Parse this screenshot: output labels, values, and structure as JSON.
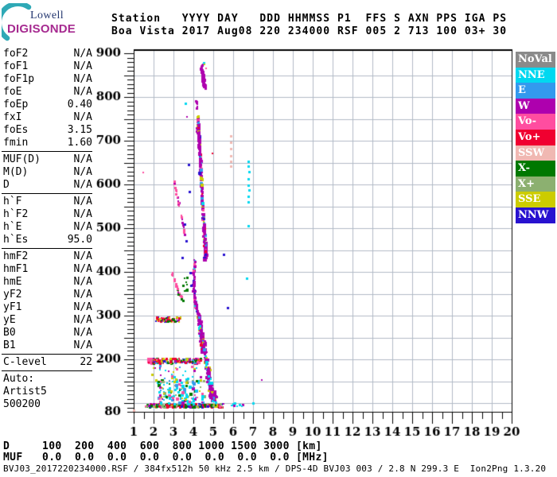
{
  "logo": {
    "top": "Lowell",
    "bottom": "DIGISONDE",
    "arc_color": "#2fa9b6"
  },
  "header": {
    "line1": "Station   YYYY DAY   DDD HHMMSS P1  FFS S AXN PPS IGA PS",
    "line2": "Boa Vista 2017 Aug08 220 234000 RSF 005 2 713 100 03+ 30"
  },
  "params": {
    "sections": [
      {
        "rows": [
          [
            "foF2",
            "N/A"
          ],
          [
            "foF1",
            "N/A"
          ],
          [
            "foF1p",
            "N/A"
          ],
          [
            "foE",
            "N/A"
          ],
          [
            "foEp",
            "0.40"
          ],
          [
            "fxI",
            "N/A"
          ],
          [
            "foEs",
            "3.15"
          ],
          [
            "fmin",
            "1.60"
          ]
        ]
      },
      {
        "rows": [
          [
            "MUF(D)",
            "N/A"
          ],
          [
            "M(D)",
            "N/A"
          ],
          [
            "D",
            "N/A"
          ]
        ]
      },
      {
        "rows": [
          [
            "h`F",
            "N/A"
          ],
          [
            "h`F2",
            "N/A"
          ],
          [
            "h`E",
            "N/A"
          ],
          [
            "h`Es",
            "95.0"
          ]
        ]
      },
      {
        "rows": [
          [
            "hmF2",
            "N/A"
          ],
          [
            "hmF1",
            "N/A"
          ],
          [
            "hmE",
            "N/A"
          ],
          [
            "yF2",
            "N/A"
          ],
          [
            "yF1",
            "N/A"
          ],
          [
            "yE",
            "N/A"
          ],
          [
            "B0",
            "N/A"
          ],
          [
            "B1",
            "N/A"
          ]
        ]
      },
      {
        "rows": [
          [
            "C-level",
            "22"
          ]
        ]
      }
    ],
    "footer": [
      "Auto:",
      "Artist5",
      "500200"
    ]
  },
  "legend": {
    "items": [
      "NoVal",
      "NNE",
      "E",
      "W",
      "Vo-",
      "Vo+",
      "SSW",
      "X-",
      "X+",
      "SSE",
      "NNW"
    ]
  },
  "footer": {
    "d_row": "D     100  200  400  600  800 1000 1500 3000 [km]",
    "muf_row": "MUF   0.0  0.0  0.0  0.0  0.0  0.0  0.0  0.0 [MHz]",
    "file_row": "BVJ03_2017220234000.RSF / 384fx512h 50 kHz 2.5 km / DPS-4D BVJ03 003 / 2.8 N 299.3 E  Ion2Png 1.3.20"
  },
  "chart_data": {
    "type": "scatter",
    "title": "Digisonde ionogram, Boa Vista, 2017 Aug08 day 220, 23:40:00",
    "xlabel": "[MHz]",
    "ylabel": "[km]",
    "xlim": [
      1,
      20
    ],
    "ylim": [
      80,
      900
    ],
    "xtick_labels": [
      1,
      2,
      3,
      4,
      5,
      6,
      7,
      8,
      9,
      10,
      11,
      12,
      13,
      14,
      15,
      16,
      17,
      18,
      19,
      20
    ],
    "ytick_labels": [
      900,
      800,
      700,
      600,
      500,
      400,
      300,
      200,
      80
    ],
    "x_minor_step": 0.5,
    "y_minor_step": 10,
    "x_grid_step": 1,
    "y_grid_step": 50,
    "grid": true,
    "grid_color": "#b2bac6",
    "legend_position": "right",
    "palette": {
      "NoVal": "#8a8a8a",
      "NNE": "#00d8f0",
      "E": "#3399ee",
      "W": "#ae00ae",
      "Vo-": "#ff4da0",
      "Vo+": "#f00030",
      "SSW": "#f0b8b2",
      "X-": "#007800",
      "X+": "#8cb070",
      "SSE": "#cccc00",
      "NNW": "#2812d0"
    },
    "features": [
      {
        "name": "spread-f-top-cluster",
        "kind": "path",
        "path": [
          [
            4.42,
            872
          ],
          [
            4.5,
            845
          ],
          [
            4.58,
            818
          ]
        ],
        "spread": [
          0.07,
          0.1
        ],
        "hj": 7,
        "count": 60,
        "colors": [
          "W",
          "W",
          "W",
          "W",
          "W",
          "W",
          "W",
          "W",
          "W",
          "Vo-"
        ],
        "size": [
          2,
          4
        ]
      },
      {
        "name": "upper-sparse-column",
        "kind": "path",
        "path": [
          [
            4.17,
            790
          ],
          [
            4.22,
            745
          ],
          [
            4.2,
            712
          ]
        ],
        "spread": [
          0.03,
          0.05
        ],
        "hj": 8,
        "count": 16,
        "colors": [
          "W"
        ],
        "size": [
          2,
          3
        ]
      },
      {
        "name": "main-spread-column",
        "kind": "path",
        "path": [
          [
            4.22,
            758
          ],
          [
            4.3,
            700
          ],
          [
            4.36,
            645
          ],
          [
            4.44,
            572
          ],
          [
            4.55,
            500
          ],
          [
            4.62,
            452
          ],
          [
            4.6,
            428
          ]
        ],
        "spread": [
          0.05,
          0.1
        ],
        "hj": 6,
        "count": 280,
        "colors": [
          "W",
          "W",
          "W",
          "W",
          "W",
          "W",
          "W",
          "W",
          "W",
          "W",
          "W",
          "W",
          "E",
          "NNE",
          "SSE",
          "Vo+",
          "NNW",
          "Vo-"
        ],
        "size": [
          2,
          4
        ]
      },
      {
        "name": "mid-column",
        "kind": "path",
        "path": [
          [
            4.1,
            428
          ],
          [
            4.04,
            395
          ],
          [
            4.03,
            362
          ],
          [
            4.1,
            330
          ],
          [
            4.22,
            305
          ]
        ],
        "spread": [
          0.05,
          0.09
        ],
        "hj": 6,
        "count": 130,
        "colors": [
          "W",
          "W",
          "W",
          "W",
          "W",
          "W",
          "W",
          "W",
          "W",
          "W",
          "NNW",
          "X-",
          "NNE",
          "Vo-"
        ],
        "size": [
          2,
          3
        ]
      },
      {
        "name": "f-trace-funnel",
        "kind": "path",
        "path": [
          [
            4.28,
            300
          ],
          [
            4.38,
            268
          ],
          [
            4.48,
            238
          ],
          [
            4.55,
            212
          ]
        ],
        "spread": [
          0.09,
          0.16
        ],
        "hj": 6,
        "count": 170,
        "colors": [
          "W",
          "W",
          "W",
          "W",
          "W",
          "W",
          "W",
          "W",
          "W",
          "NNE",
          "E",
          "SSE",
          "Vo+"
        ],
        "size": [
          2,
          4
        ]
      },
      {
        "name": "lower-spread",
        "kind": "path",
        "path": [
          [
            4.62,
            205
          ],
          [
            4.75,
            165
          ],
          [
            4.9,
            128
          ],
          [
            5.02,
            104
          ]
        ],
        "spread": [
          0.12,
          0.25
        ],
        "hj": 7,
        "count": 150,
        "colors": [
          "W",
          "W",
          "W",
          "W",
          "W",
          "W",
          "W",
          "W",
          "NNE",
          "NNE",
          "E",
          "SSE"
        ],
        "size": [
          2,
          4
        ]
      },
      {
        "name": "oblique-trace-upper",
        "kind": "path",
        "path": [
          [
            3.02,
            610
          ],
          [
            3.3,
            548
          ],
          [
            3.58,
            485
          ]
        ],
        "spread": [
          0.03,
          0.03
        ],
        "hj": 5,
        "count": 28,
        "colors": [
          "Vo-",
          "Vo-",
          "Vo-",
          "W"
        ],
        "size": [
          2,
          3
        ]
      },
      {
        "name": "oblique-trace-lower",
        "kind": "path",
        "path": [
          [
            2.95,
            398
          ],
          [
            3.12,
            372
          ],
          [
            3.32,
            348
          ],
          [
            3.52,
            332
          ]
        ],
        "spread": [
          0.05,
          0.05
        ],
        "hj": 5,
        "count": 26,
        "colors": [
          "Vo-",
          "Vo-",
          "Vo-",
          "W",
          "X-"
        ],
        "size": [
          2,
          3
        ]
      },
      {
        "name": "green-cluster",
        "kind": "box",
        "f": [
          3.5,
          3.72
        ],
        "h": [
          350,
          388
        ],
        "count": 9,
        "colors": [
          "X-"
        ],
        "size": [
          2,
          3
        ]
      },
      {
        "name": "multiple-echo-band-290km",
        "kind": "box",
        "f": [
          2.12,
          3.38
        ],
        "h": [
          286,
          297
        ],
        "count": 55,
        "colors": [
          "Vo+",
          "Vo+",
          "Vo+",
          "X-",
          "X-",
          "W",
          "SSE",
          "Vo-",
          "NNW"
        ],
        "size": [
          2,
          3
        ]
      },
      {
        "name": "es-second-hop-pink-blob",
        "kind": "box",
        "f": [
          1.72,
          1.97
        ],
        "h": [
          191,
          200
        ],
        "count": 32,
        "colors": [
          "Vo-",
          "Vo-",
          "Vo-",
          "Vo-",
          "Vo+"
        ],
        "size": [
          2,
          4
        ]
      },
      {
        "name": "es-second-hop-band-195km",
        "kind": "box",
        "f": [
          1.97,
          4.38
        ],
        "h": [
          190,
          202
        ],
        "count": 190,
        "colors": [
          "Vo+",
          "Vo+",
          "Vo+",
          "X-",
          "X-",
          "SSE",
          "SSE",
          "W",
          "E",
          "X+",
          "NNW",
          "Vo-"
        ],
        "size": [
          2,
          3
        ]
      },
      {
        "name": "es-band-95km",
        "kind": "box",
        "f": [
          1.6,
          5.45
        ],
        "h": [
          90,
          97
        ],
        "count": 290,
        "colors": [
          "Vo+",
          "Vo+",
          "Vo+",
          "X-",
          "X-",
          "X-",
          "SSE",
          "X+",
          "X+",
          "W",
          "NNW",
          "Vo-"
        ],
        "size": [
          2,
          3
        ]
      },
      {
        "name": "es-band-tail",
        "kind": "box",
        "f": [
          5.45,
          6.6
        ],
        "h": [
          92,
          100
        ],
        "count": 9,
        "colors": [
          "NNE",
          "NNE",
          "W"
        ],
        "size": [
          2,
          3
        ]
      },
      {
        "name": "scatter-above-es",
        "kind": "box",
        "f": [
          2.15,
          4.55
        ],
        "h": [
          98,
          152
        ],
        "count": 140,
        "colors": [
          "NNE",
          "NNE",
          "NNE",
          "NNE",
          "E",
          "E",
          "W",
          "SSE",
          "Vo-",
          "X-",
          "X+"
        ],
        "size": [
          2,
          4
        ]
      },
      {
        "name": "scatter-above-es-sparse",
        "kind": "box",
        "f": [
          1.85,
          4.9
        ],
        "h": [
          150,
          186
        ],
        "count": 35,
        "colors": [
          "NNE",
          "NNE",
          "E",
          "W",
          "Vo-",
          "SSE"
        ],
        "size": [
          2,
          3
        ]
      },
      {
        "name": "ssw-dotted-column",
        "kind": "dots",
        "color": "SSW",
        "points": [
          [
            5.88,
            710
          ],
          [
            5.88,
            696
          ],
          [
            5.9,
            681
          ],
          [
            5.88,
            664
          ],
          [
            5.9,
            652
          ],
          [
            5.88,
            641
          ],
          [
            1.02,
            83
          ]
        ],
        "size": [
          3,
          3
        ]
      },
      {
        "name": "nne-dashed-column",
        "kind": "dots",
        "color": "NNE",
        "points": [
          [
            6.78,
            652
          ],
          [
            6.78,
            641
          ],
          [
            6.8,
            629
          ],
          [
            6.78,
            612
          ],
          [
            6.78,
            598
          ],
          [
            6.8,
            586
          ],
          [
            6.78,
            572
          ],
          [
            6.78,
            559
          ],
          [
            6.78,
            505
          ],
          [
            6.7,
            385
          ],
          [
            3.6,
            785
          ],
          [
            6.35,
            96
          ],
          [
            7.0,
            99
          ],
          [
            4.52,
            878
          ]
        ],
        "size": [
          3,
          3
        ]
      },
      {
        "name": "nnw-scattered-dots",
        "kind": "dots",
        "color": "NNW",
        "points": [
          [
            3.76,
            644
          ],
          [
            3.82,
            582
          ],
          [
            3.56,
            508
          ],
          [
            3.64,
            470
          ],
          [
            3.46,
            432
          ],
          [
            5.74,
            318
          ],
          [
            3.9,
            368
          ],
          [
            3.84,
            398
          ],
          [
            5.55,
            440
          ],
          [
            2.52,
            196
          ]
        ],
        "size": [
          3,
          3
        ]
      },
      {
        "name": "w-isolated-dots",
        "kind": "dots",
        "color": "W",
        "points": [
          [
            7.42,
            153
          ],
          [
            3.68,
            755
          ]
        ],
        "size": [
          2,
          3
        ]
      },
      {
        "name": "vo-plus-isolated-dots",
        "kind": "dots",
        "color": "Vo+",
        "points": [
          [
            4.96,
            671
          ]
        ],
        "size": [
          2,
          2
        ]
      },
      {
        "name": "vo-minus-isolated-dots",
        "kind": "dots",
        "color": "Vo-",
        "points": [
          [
            1.48,
            628
          ],
          [
            4.62,
            866
          ]
        ],
        "size": [
          2,
          2
        ]
      },
      {
        "name": "sse-isolated-dots",
        "kind": "dots",
        "color": "SSE",
        "points": [
          [
            4.56,
            874
          ]
        ],
        "size": [
          2,
          2
        ]
      }
    ]
  }
}
